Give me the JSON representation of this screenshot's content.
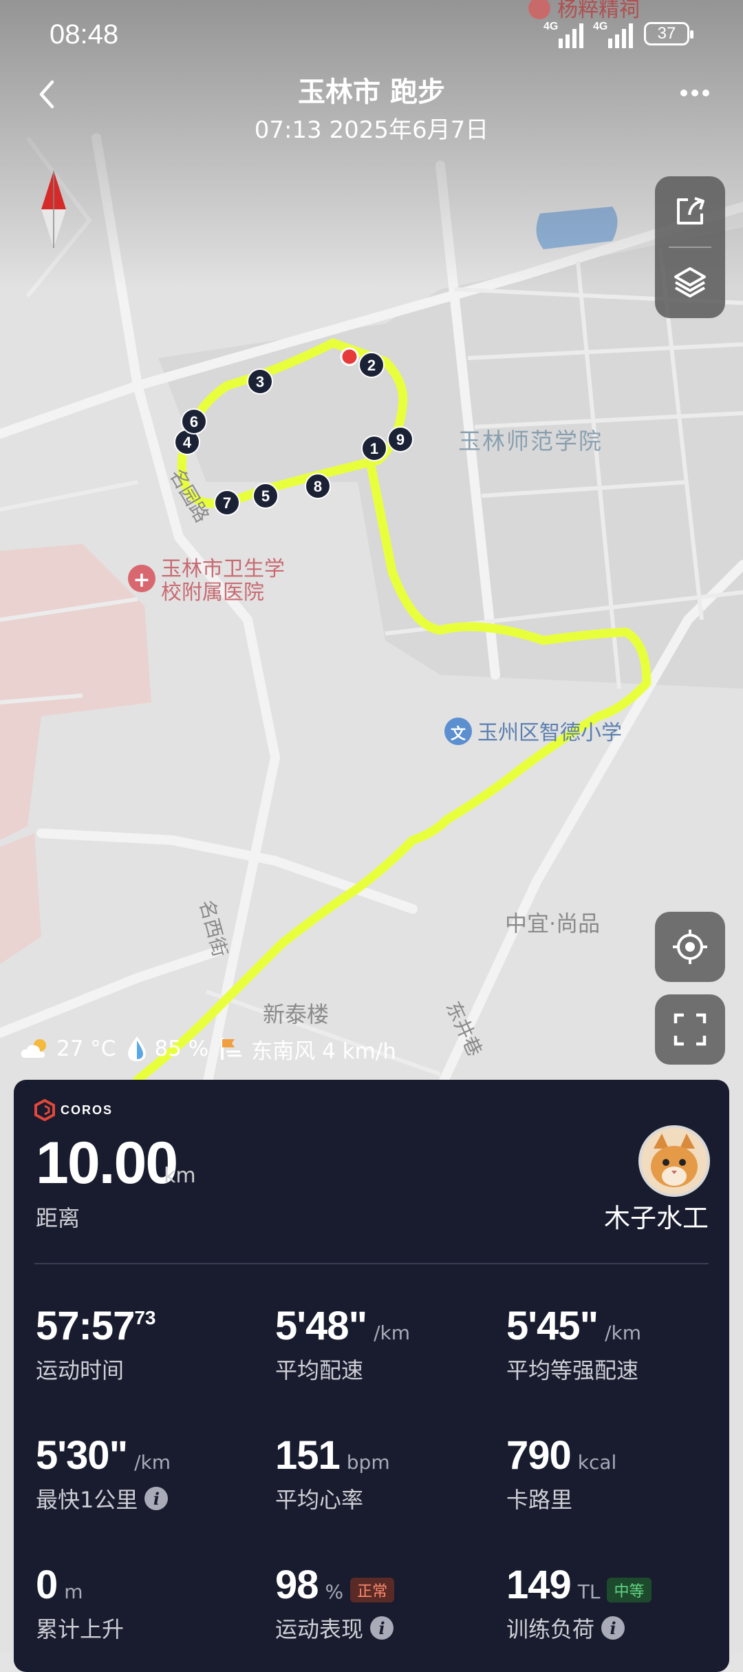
{
  "status_bar": {
    "time": "08:48",
    "network1": "4G",
    "network2": "4G",
    "battery": "37"
  },
  "header": {
    "title": "玉林市 跑步",
    "subtitle": "07:13 2025年6月7日"
  },
  "map": {
    "labels": {
      "shop": "杨粹精祠",
      "college": "玉林师范学院",
      "hospital_line1": "玉林市卫生学",
      "hospital_line2": "校附属医院",
      "school": "玉州区智德小学",
      "building1": "中宜·尚品",
      "building2": "新泰楼",
      "road1": "名园路",
      "road2": "名西街",
      "road3": "东井巷"
    },
    "lap_markers": [
      "1",
      "2",
      "3",
      "4",
      "5",
      "6",
      "7",
      "8",
      "9"
    ]
  },
  "weather": {
    "temperature": "27 °C",
    "humidity": "85 %",
    "wind": "东南风 4 km/h"
  },
  "summary": {
    "brand": "COROS",
    "distance_value": "10.00",
    "distance_unit": "km",
    "distance_label": "距离",
    "username": "木子水工"
  },
  "stats": [
    {
      "value": "57:57",
      "sup": "73",
      "unit": "",
      "label": "运动时间"
    },
    {
      "value": "5'48\"",
      "unit": "/km",
      "label": "平均配速"
    },
    {
      "value": "5'45\"",
      "unit": "/km",
      "label": "平均等强配速"
    },
    {
      "value": "5'30\"",
      "unit": "/km",
      "label": "最快1公里"
    },
    {
      "value": "151",
      "unit": "bpm",
      "label": "平均心率"
    },
    {
      "value": "790",
      "unit": "kcal",
      "label": "卡路里"
    },
    {
      "value": "0",
      "unit": "m",
      "label": "累计上升"
    },
    {
      "value": "98",
      "unit": "%",
      "badge": "正常",
      "label": "运动表现"
    },
    {
      "value": "149",
      "unit": "TL",
      "badge": "中等",
      "label": "训练负荷"
    }
  ],
  "colors": {
    "route": "#e8ff3c",
    "panel_bg": "#181c2e",
    "start_dot": "#e63b3b"
  }
}
